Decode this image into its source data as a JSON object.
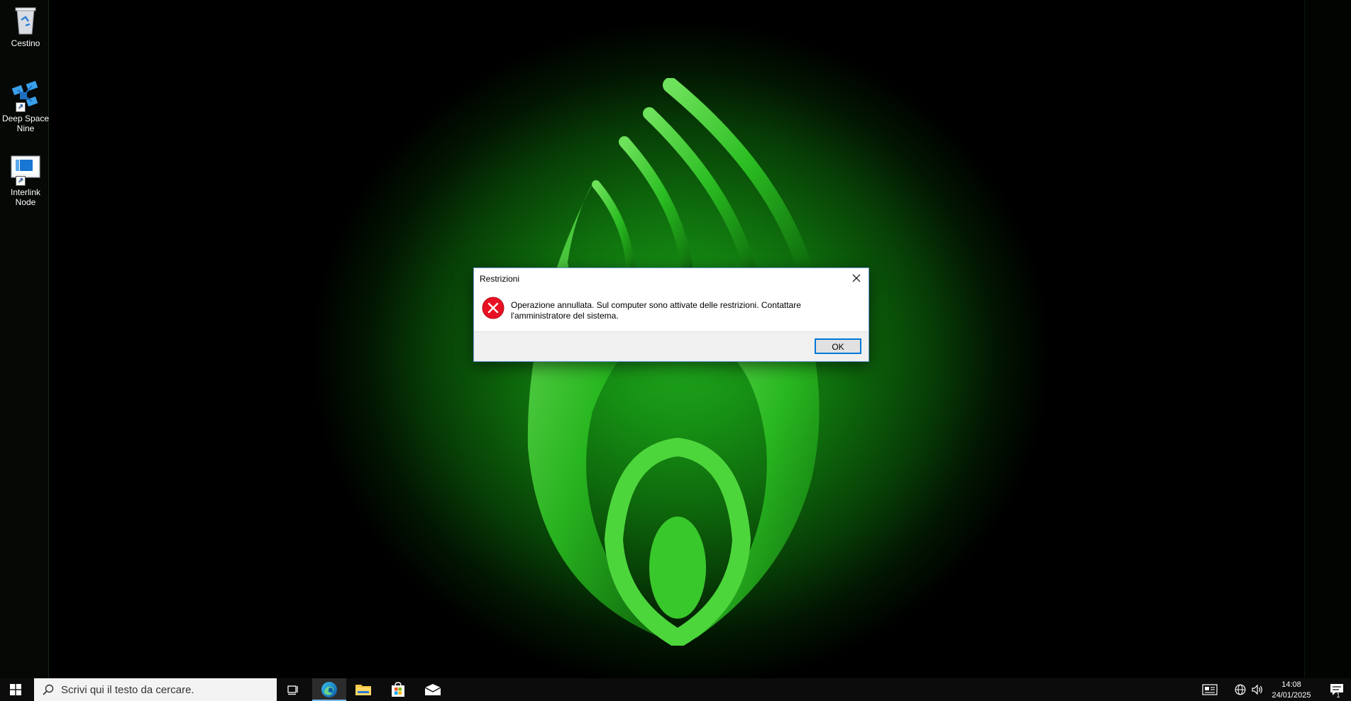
{
  "desktop": {
    "icons": [
      {
        "label": "Cestino",
        "icon": "recycle-bin-icon"
      },
      {
        "label": "Deep Space\nNine",
        "icon": "network-shortcut-icon"
      },
      {
        "label": "Interlink\nNode",
        "icon": "remote-desktop-shortcut-icon"
      }
    ],
    "wallpaper_color": "#1fa51c"
  },
  "dialog": {
    "title": "Restrizioni",
    "message": "Operazione annullata. Sul computer sono attivate delle restrizioni. Contattare l'amministratore del sistema.",
    "ok_label": "OK",
    "icon": "error-icon"
  },
  "taskbar": {
    "search_placeholder": "Scrivi qui il testo da cercare.",
    "apps": [
      "task-view",
      "edge",
      "file-explorer",
      "microsoft-store",
      "mail"
    ],
    "clock": {
      "time": "14:08",
      "date": "24/01/2025"
    },
    "notification_count": "1"
  },
  "colors": {
    "accent": "#0078d7",
    "error": "#e81123",
    "taskbar": "#0c0c0c"
  }
}
